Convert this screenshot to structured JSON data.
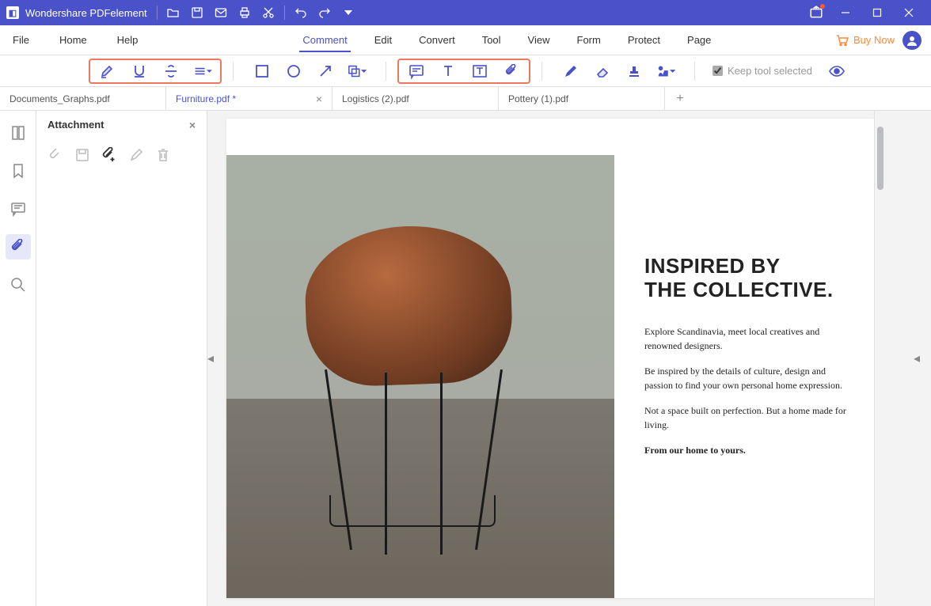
{
  "app": {
    "title": "Wondershare PDFelement"
  },
  "titlebar_icons": [
    "folder",
    "save",
    "mail",
    "print",
    "cut",
    "undo",
    "redo",
    "dropdown",
    "share"
  ],
  "menubar": {
    "left": [
      {
        "label": "File"
      },
      {
        "label": "Home"
      },
      {
        "label": "Help"
      }
    ],
    "center": [
      {
        "label": "Comment",
        "active": true
      },
      {
        "label": "Edit"
      },
      {
        "label": "Convert"
      },
      {
        "label": "Tool"
      },
      {
        "label": "View"
      },
      {
        "label": "Form"
      },
      {
        "label": "Protect"
      },
      {
        "label": "Page"
      }
    ],
    "buy_now": "Buy Now"
  },
  "toolbar": {
    "keep_tool_label": "Keep tool selected"
  },
  "tabs": [
    {
      "label": "Documents_Graphs.pdf",
      "active": false,
      "closeable": false
    },
    {
      "label": "Furniture.pdf *",
      "active": true,
      "closeable": true
    },
    {
      "label": "Logistics (2).pdf",
      "active": false,
      "closeable": false
    },
    {
      "label": "Pottery (1).pdf",
      "active": false,
      "closeable": false
    }
  ],
  "panel": {
    "title": "Attachment"
  },
  "document": {
    "headline_line1": "INSPIRED BY",
    "headline_line2": "THE COLLECTIVE.",
    "para1": "Explore Scandinavia, meet local creatives and renowned designers.",
    "para2": "Be inspired by the details of culture, design and passion to find your own personal home expression.",
    "para3": "Not a space built on perfection. But a home made for living.",
    "tagline": "From our home to yours."
  }
}
